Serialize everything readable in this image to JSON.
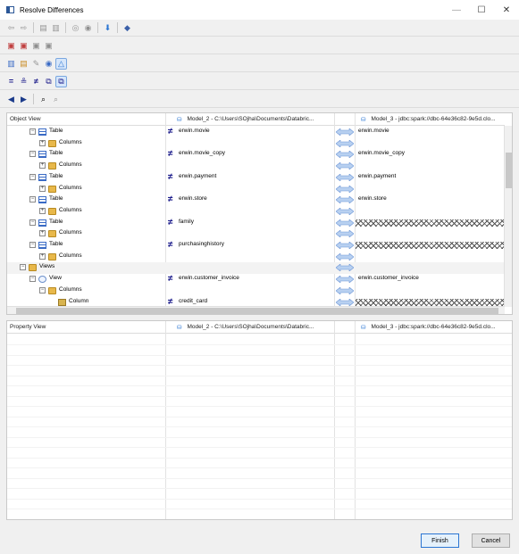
{
  "window": {
    "title": "Resolve Differences",
    "minimize": "—",
    "maximize": "☐",
    "close": "✕"
  },
  "object_view": {
    "header": "Object View",
    "left_model": "Model_2 - C:\\Users\\SOjha\\Documents\\Databric...",
    "right_model": "Model_3 - jdbc:spark://dbc-64e36c82-9e5d.clo...",
    "rows": [
      {
        "level": 2,
        "expander": "⊟",
        "icon": "table-icon",
        "label": "Table",
        "left": "erwin.movie",
        "right": "erwin.movie",
        "diff": true,
        "missing_right": false
      },
      {
        "level": 3,
        "expander": "⊞",
        "icon": "folder-icon",
        "label": "Columns",
        "left": "",
        "right": "",
        "diff": false,
        "missing_right": false
      },
      {
        "level": 2,
        "expander": "⊟",
        "icon": "table-icon",
        "label": "Table",
        "left": "erwin.movie_copy",
        "right": "erwin.movie_copy",
        "diff": true,
        "missing_right": false
      },
      {
        "level": 3,
        "expander": "⊞",
        "icon": "folder-icon",
        "label": "Columns",
        "left": "",
        "right": "",
        "diff": false,
        "missing_right": false
      },
      {
        "level": 2,
        "expander": "⊟",
        "icon": "table-icon",
        "label": "Table",
        "left": "erwin.payment",
        "right": "erwin.payment",
        "diff": true,
        "missing_right": false
      },
      {
        "level": 3,
        "expander": "⊞",
        "icon": "folder-icon",
        "label": "Columns",
        "left": "",
        "right": "",
        "diff": false,
        "missing_right": false
      },
      {
        "level": 2,
        "expander": "⊟",
        "icon": "table-icon",
        "label": "Table",
        "left": "erwin.store",
        "right": "erwin.store",
        "diff": true,
        "missing_right": false
      },
      {
        "level": 3,
        "expander": "⊞",
        "icon": "folder-icon",
        "label": "Columns",
        "left": "",
        "right": "",
        "diff": false,
        "missing_right": false
      },
      {
        "level": 2,
        "expander": "⊟",
        "icon": "table-icon",
        "label": "Table",
        "left": "family",
        "right": "",
        "diff": true,
        "missing_right": true
      },
      {
        "level": 3,
        "expander": "⊞",
        "icon": "folder-icon",
        "label": "Columns",
        "left": "",
        "right": "",
        "diff": false,
        "missing_right": false
      },
      {
        "level": 2,
        "expander": "⊟",
        "icon": "table-icon",
        "label": "Table",
        "left": "purchasinghistory",
        "right": "",
        "diff": true,
        "missing_right": true
      },
      {
        "level": 3,
        "expander": "⊞",
        "icon": "folder-icon",
        "label": "Columns",
        "left": "",
        "right": "",
        "diff": false,
        "missing_right": false
      },
      {
        "level": 1,
        "expander": "⊟",
        "icon": "folder-icon",
        "label": "Views",
        "left": "",
        "right": "",
        "diff": false,
        "missing_right": false,
        "selected": true
      },
      {
        "level": 2,
        "expander": "⊟",
        "icon": "view-icon",
        "label": "View",
        "left": "erwin.customer_invoice",
        "right": "erwin.customer_invoice",
        "diff": true,
        "missing_right": false
      },
      {
        "level": 3,
        "expander": "⊟",
        "icon": "folder-icon",
        "label": "Columns",
        "left": "",
        "right": "",
        "diff": false,
        "missing_right": false
      },
      {
        "level": 4,
        "expander": "",
        "icon": "column-icon",
        "label": "Column",
        "left": "credit_card",
        "right": "",
        "diff": true,
        "missing_right": true
      }
    ]
  },
  "property_view": {
    "header": "Property View",
    "left_model": "Model_2 - C:\\Users\\SOjha\\Documents\\Databric...",
    "right_model": "Model_3 - jdbc:spark://dbc-64e36c82-9e5d.clo..."
  },
  "buttons": {
    "finish": "Finish",
    "cancel": "Cancel"
  },
  "colors": {
    "accent": "#2b76d3",
    "not_equal": "#1a1a8a",
    "arrow": "#7aa7e0"
  }
}
